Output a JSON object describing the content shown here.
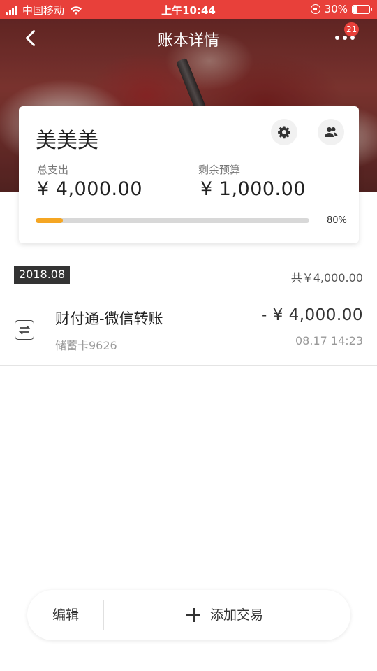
{
  "status_bar": {
    "carrier": "中国移动",
    "time": "上午10:44",
    "battery": "30%",
    "battery_level": 0.3
  },
  "nav": {
    "title": "账本详情",
    "badge_count": "21"
  },
  "book": {
    "name": "美美美",
    "total_spend_label": "总支出",
    "total_spend_value": "¥ 4,000.00",
    "remaining_label": "剩余预算",
    "remaining_value": "¥ 1,000.00",
    "progress_percent": 80,
    "progress_label": "80%",
    "progress_fill_fraction": 0.1,
    "colors": {
      "progress_fill": "#f5a623",
      "progress_track": "#d8d8d8"
    }
  },
  "month": {
    "label": "2018.08",
    "total": "共￥4,000.00"
  },
  "transactions": [
    {
      "title": "财付通-微信转账",
      "account": "储蓄卡9626",
      "amount": "- ¥ 4,000.00",
      "time": "08.17 14:23",
      "icon": "transfer-icon"
    }
  ],
  "bottom_bar": {
    "edit_label": "编辑",
    "add_label": "添加交易"
  },
  "colors": {
    "accent": "#e8403a"
  }
}
